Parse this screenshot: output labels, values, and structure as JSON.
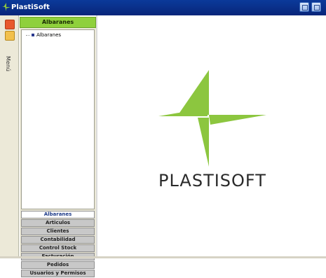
{
  "window": {
    "title": "PlastiSoft"
  },
  "sidebar": {
    "menu_label": "Menú"
  },
  "panel": {
    "header": "Albaranes",
    "tree": {
      "items": [
        {
          "label": "Albaranes"
        }
      ]
    },
    "nav_buttons": [
      {
        "label": "Albaranes",
        "active": true
      },
      {
        "label": "Articulos"
      },
      {
        "label": "Clientes"
      },
      {
        "label": "Contabilidad"
      },
      {
        "label": "Control Stock"
      },
      {
        "label": "Facturación"
      },
      {
        "label": "Pedidos"
      },
      {
        "label": "Usuarios y Permisos"
      }
    ]
  },
  "logo": {
    "text": "PLASTISOFT"
  },
  "colors": {
    "titlebar": "#0b3a9a",
    "accent_green": "#8fd03c",
    "logo_green": "#8cc63f"
  }
}
